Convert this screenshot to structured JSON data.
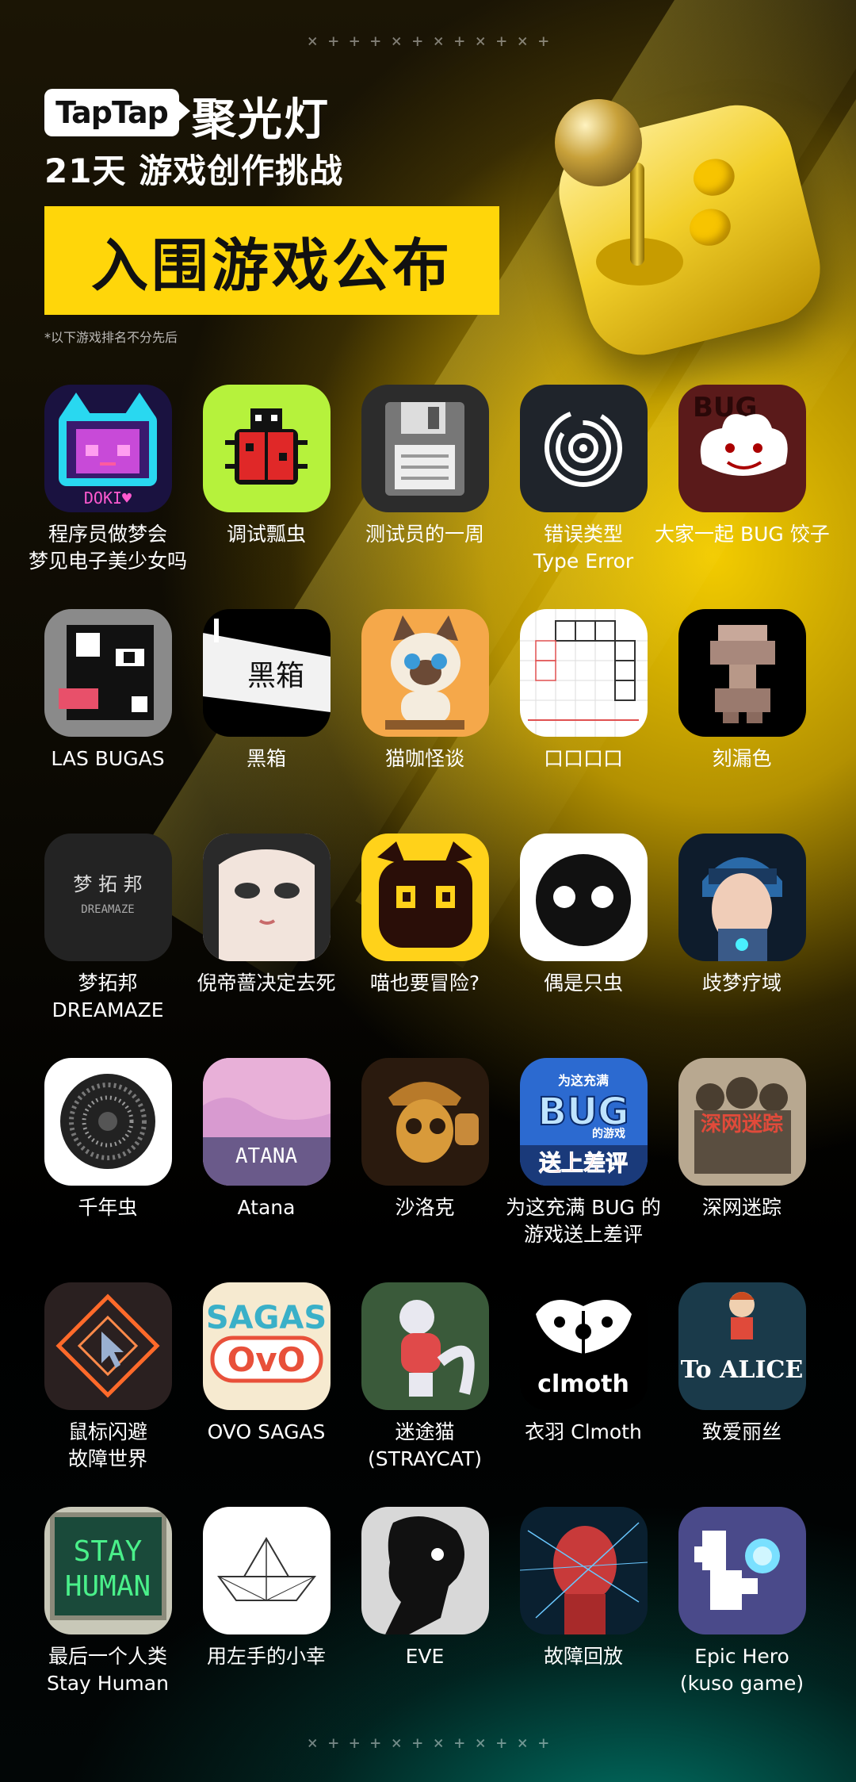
{
  "header": {
    "brand": "TapTap",
    "program": "聚光灯",
    "subtitle": "21天 游戏创作挑战",
    "banner": "入围游戏公布",
    "note": "*以下游戏排名不分先后"
  },
  "decor": {
    "marks": "× + + + × + × + × + × +"
  },
  "colors": {
    "accent": "#ffd60a",
    "background": "#000000"
  },
  "games": [
    {
      "label": "程序员做梦会\n梦见电子美少女吗",
      "icon": "doki-girl-icon"
    },
    {
      "label": "调试瓢虫",
      "icon": "ladybug-icon"
    },
    {
      "label": "测试员的一周",
      "icon": "floppy-disk-icon"
    },
    {
      "label": "错误类型\nType Error",
      "icon": "target-spiral-icon"
    },
    {
      "label": "大家一起 BUG 饺子",
      "icon": "dumpling-icon"
    },
    {
      "label": "LAS BUGAS",
      "icon": "pixel-face-icon"
    },
    {
      "label": "黑箱",
      "icon": "black-box-icon"
    },
    {
      "label": "猫咖怪谈",
      "icon": "siamese-cat-icon"
    },
    {
      "label": "口口口口",
      "icon": "block-puzzle-icon"
    },
    {
      "label": "刻漏色",
      "icon": "pixel-figure-icon"
    },
    {
      "label": "梦拓邦\nDREAMAZE",
      "icon": "dreamaze-icon"
    },
    {
      "label": "倪帝蔷决定去死",
      "icon": "anime-face-icon"
    },
    {
      "label": "喵也要冒险?",
      "icon": "black-cat-icon"
    },
    {
      "label": "偶是只虫",
      "icon": "bug-eyes-icon"
    },
    {
      "label": "歧梦疗域",
      "icon": "cyber-head-icon"
    },
    {
      "label": "千年虫",
      "icon": "noise-circle-icon"
    },
    {
      "label": "Atana",
      "icon": "atana-icon"
    },
    {
      "label": "沙洛克",
      "icon": "detective-icon"
    },
    {
      "label": "为这充满 BUG 的\n游戏送上差评",
      "icon": "bug-review-icon"
    },
    {
      "label": "深网迷踪",
      "icon": "deep-web-icon"
    },
    {
      "label": "鼠标闪避\n故障世界",
      "icon": "cursor-diamond-icon"
    },
    {
      "label": "OVO SAGAS",
      "icon": "ovo-sagas-icon"
    },
    {
      "label": "迷途猫\n(STRAYCAT)",
      "icon": "straycat-icon"
    },
    {
      "label": "衣羽 Clmoth",
      "icon": "moth-icon"
    },
    {
      "label": "致爱丽丝",
      "icon": "to-alice-icon"
    },
    {
      "label": "最后一个人类\nStay Human",
      "icon": "stay-human-icon"
    },
    {
      "label": "用左手的小幸",
      "icon": "paper-boat-icon"
    },
    {
      "label": "EVE",
      "icon": "eve-silhouette-icon"
    },
    {
      "label": "故障回放",
      "icon": "glitch-head-icon"
    },
    {
      "label": "Epic Hero\n(kuso game)",
      "icon": "pixel-fairy-icon"
    }
  ],
  "icon_text": {
    "doki": "DOKI♥",
    "floppy_hint": "",
    "heixiang": "黑箱",
    "dreamaze_cn": "梦 拓 邦",
    "dreamaze_en": "DREAMAZE",
    "atana": "ATANA",
    "bug_top": "为这充满",
    "bug_big": "BUG",
    "bug_mid": "的游戏",
    "bug_bottom": "送上差评",
    "deepweb": "深网迷踪",
    "sagas": "SAGAS",
    "ovo": "OvO",
    "clmoth": "clmoth",
    "to_alice": "To ALICE",
    "stay": "STAY",
    "human": "HUMAN",
    "bug_dumpling": "BUG"
  }
}
